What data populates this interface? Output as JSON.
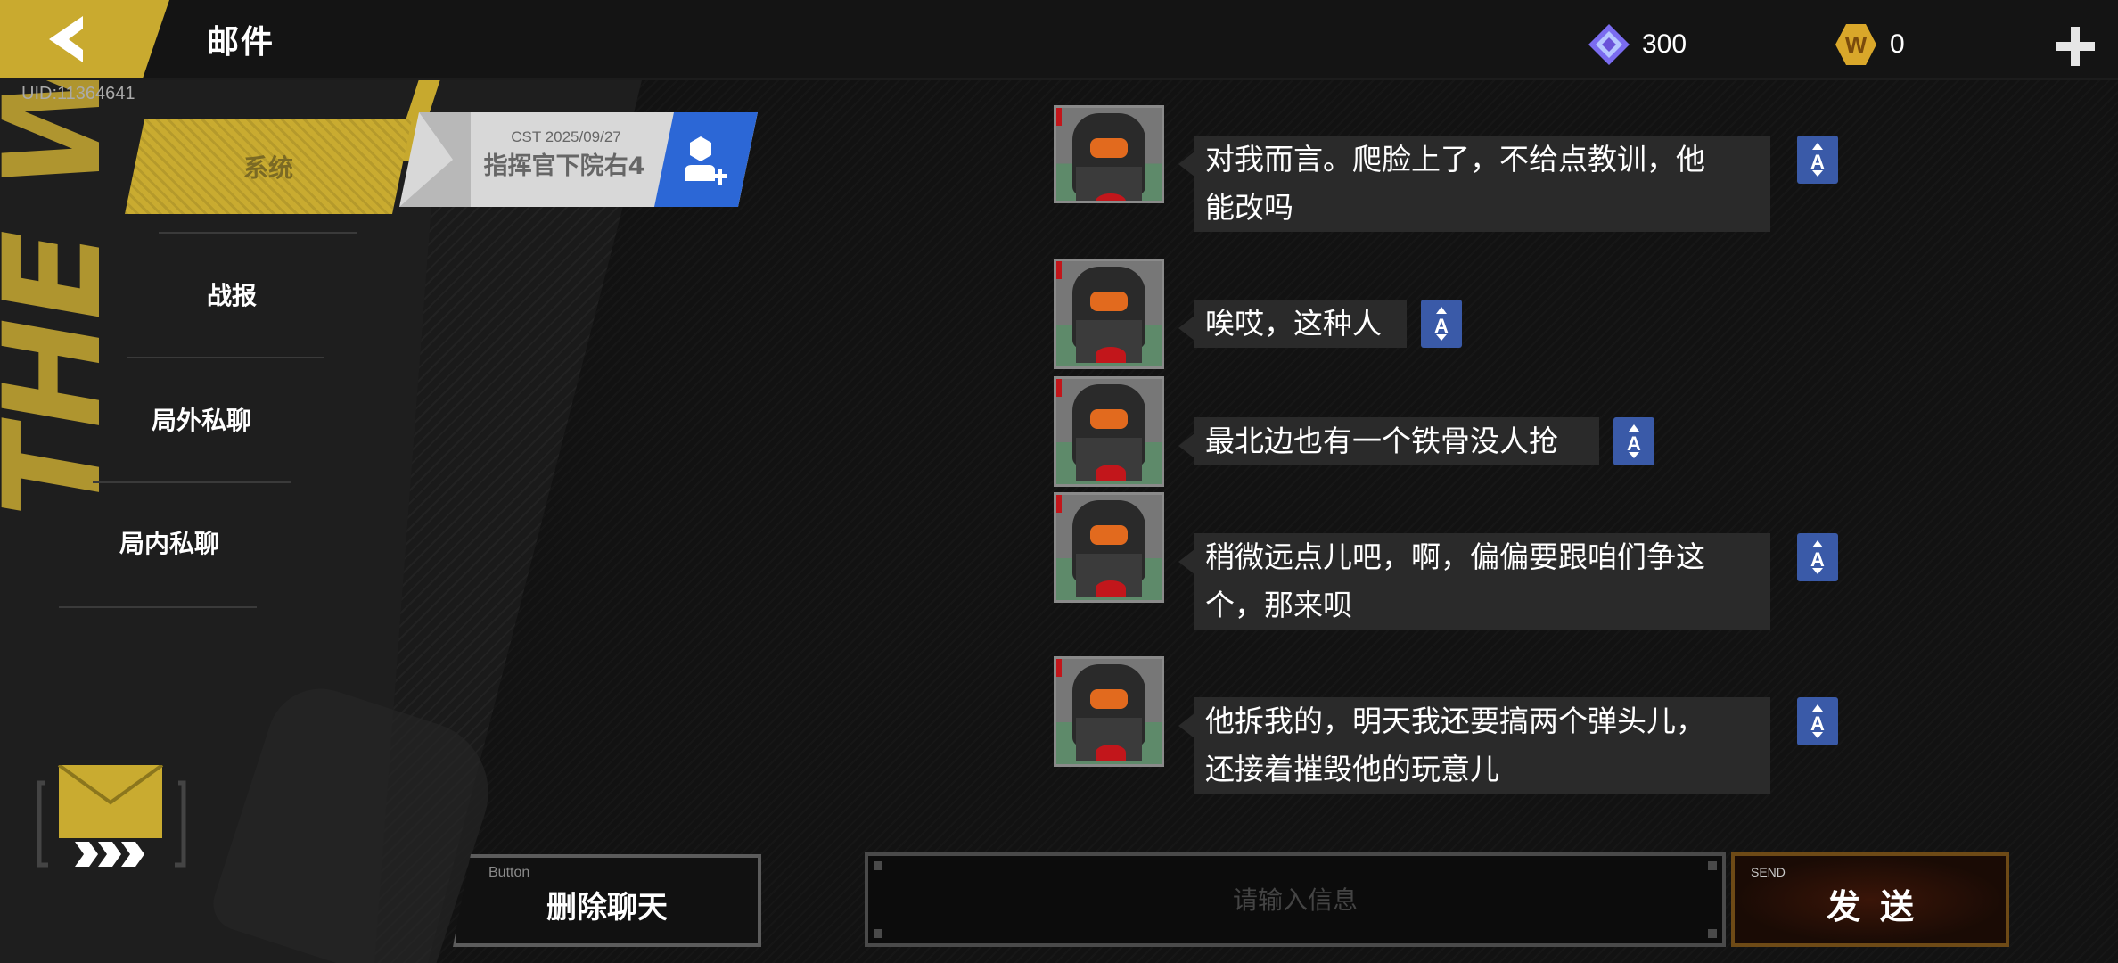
{
  "header": {
    "title": "邮件",
    "uid": "UID:11364641",
    "currencies": [
      {
        "icon": "diamond-icon",
        "value": "300",
        "color": "#7b6cf0"
      },
      {
        "icon": "w-coin-icon",
        "value": "0",
        "color": "#d9a72a"
      }
    ]
  },
  "sidebar": {
    "tabs": [
      {
        "label": "系统",
        "active": true
      },
      {
        "label": "战报",
        "active": false
      },
      {
        "label": "局外私聊",
        "active": false
      },
      {
        "label": "局内私聊",
        "active": false
      }
    ]
  },
  "contact": {
    "date": "CST 2025/09/27",
    "name": "指挥官下院右4"
  },
  "messages": [
    {
      "lines": [
        "对我而言。爬脸上了，不给点教训，他",
        "能改吗"
      ]
    },
    {
      "lines": [
        "唉哎，这种人"
      ]
    },
    {
      "lines": [
        "最北边也有一个铁骨没人抢"
      ]
    },
    {
      "lines": [
        "稍微远点儿吧，啊，偏偏要跟咱们争这",
        "个，那来呗"
      ]
    },
    {
      "lines": [
        "他拆我的，明天我还要搞两个弹头儿，",
        "还接着摧毁他的玩意儿"
      ]
    }
  ],
  "controls": {
    "delete": {
      "sub": "Button",
      "label": "删除聊天"
    },
    "input": {
      "placeholder": "请输入信息",
      "value": ""
    },
    "send": {
      "sub": "SEND",
      "label": "发送"
    }
  },
  "colors": {
    "accent_yellow": "#c9ab30",
    "contact_blue": "#2c67d6",
    "translate_blue": "#3a5aa8",
    "avatar_orange": "#e26a1e"
  }
}
